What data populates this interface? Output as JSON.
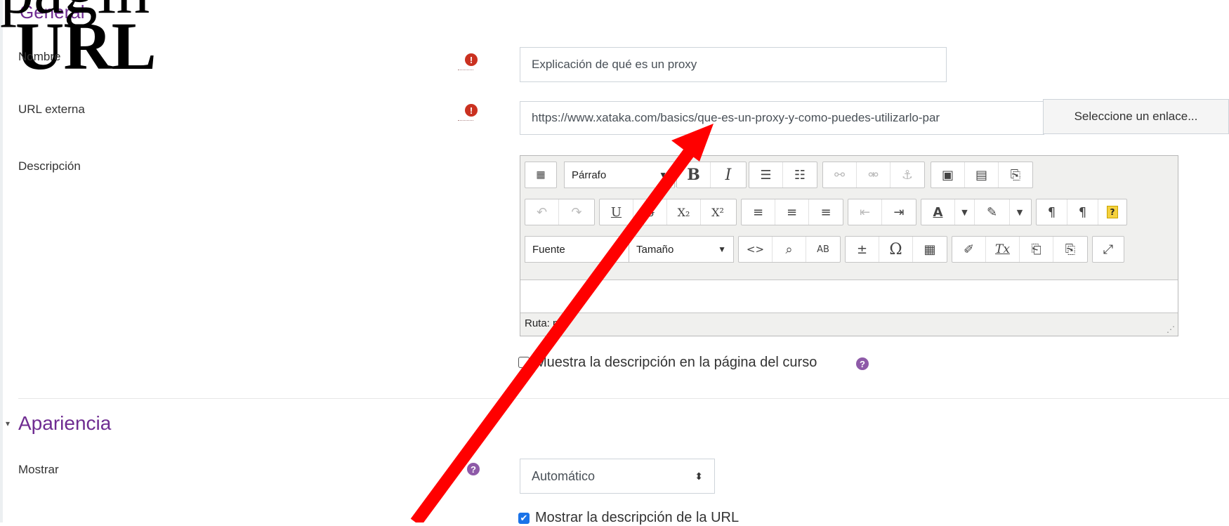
{
  "overlay": {
    "title_line1": "págin",
    "title_line2": "URL"
  },
  "general": {
    "title": "General",
    "nombre": {
      "label": "Nombre",
      "value": "Explicación de qué es un proxy"
    },
    "url": {
      "label": "URL externa",
      "value": "https://www.xataka.com/basics/que-es-un-proxy-y-como-puedes-utilizarlo-par",
      "button": "Seleccione un enlace..."
    },
    "descripcion": {
      "label": "Descripción"
    },
    "editor": {
      "paragraph_select": "Párrafo",
      "font_select": "Fuente",
      "size_select": "Tamaño",
      "status": "Ruta: p"
    },
    "show_description": "Muestra la descripción en la página del curso"
  },
  "apariencia": {
    "title": "Apariencia",
    "mostrar": {
      "label": "Mostrar",
      "value": "Automático"
    },
    "show_url_description": "Mostrar la descripción de la URL"
  },
  "colors": {
    "accent": "#6f2c91",
    "required": "#ca3120",
    "arrow": "#ff0000"
  },
  "icons": [
    "error-icon",
    "help-icon",
    "bold-icon",
    "italic-icon",
    "link-icon",
    "image-icon",
    "arrow-annotation"
  ]
}
